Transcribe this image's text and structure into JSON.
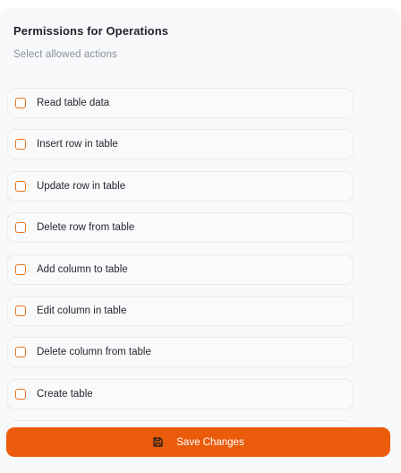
{
  "header": {
    "title": "Permissions for Operations",
    "subtitle": "Select allowed actions"
  },
  "permissions": [
    {
      "label": "Read table data",
      "checked": false
    },
    {
      "label": "Insert row in table",
      "checked": false
    },
    {
      "label": "Update row in table",
      "checked": false
    },
    {
      "label": "Delete row from table",
      "checked": false
    },
    {
      "label": "Add column to table",
      "checked": false
    },
    {
      "label": "Edit column in table",
      "checked": false
    },
    {
      "label": "Delete column from table",
      "checked": false
    },
    {
      "label": "Create table",
      "checked": false
    }
  ],
  "footer": {
    "save_label": "Save Changes",
    "save_icon": "save-icon"
  },
  "colors": {
    "accent": "#ea5b0c",
    "checkbox_border": "#e9741c"
  }
}
